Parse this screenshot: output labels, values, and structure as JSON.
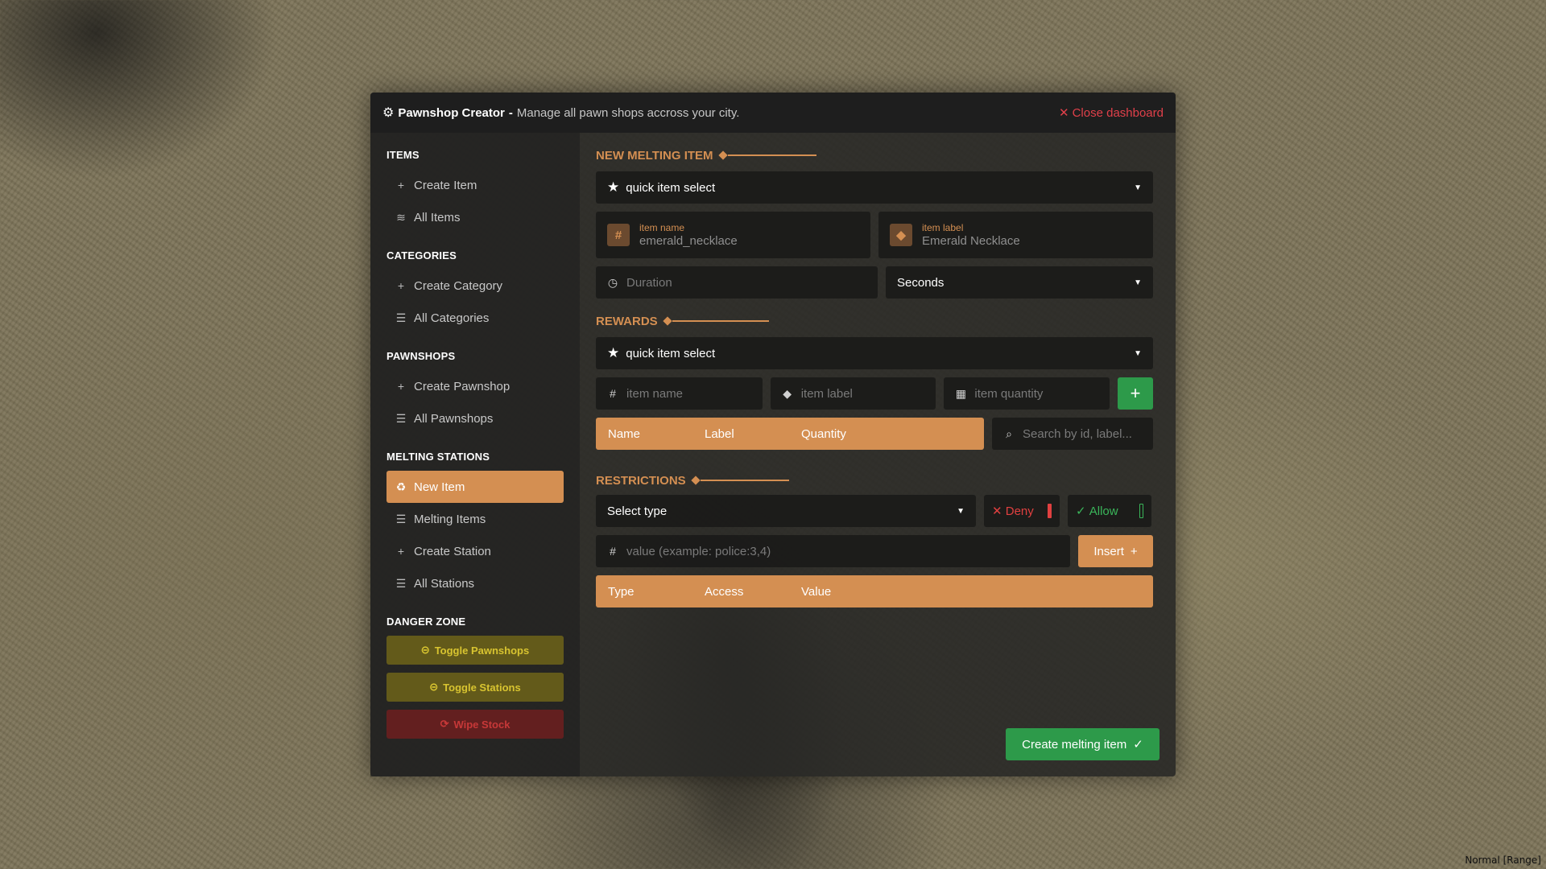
{
  "header": {
    "title": "Pawnshop Creator",
    "separator": "-",
    "subtitle": "Manage all pawn shops accross your city.",
    "close_label": "Close dashboard"
  },
  "sidebar": {
    "items_title": "ITEMS",
    "create_item": "Create Item",
    "all_items": "All Items",
    "categories_title": "CATEGORIES",
    "create_category": "Create Category",
    "all_categories": "All Categories",
    "pawnshops_title": "PAWNSHOPS",
    "create_pawnshop": "Create Pawnshop",
    "all_pawnshops": "All Pawnshops",
    "melting_title": "MELTING STATIONS",
    "new_item": "New Item",
    "melting_items": "Melting Items",
    "create_station": "Create Station",
    "all_stations": "All Stations",
    "danger_title": "DANGER ZONE",
    "toggle_pawnshops": "Toggle Pawnshops",
    "toggle_stations": "Toggle Stations",
    "wipe_stock": "Wipe Stock"
  },
  "new_melting": {
    "title": "NEW MELTING ITEM",
    "quick_select": "quick item select",
    "item_name_label": "item name",
    "item_name_value": "emerald_necklace",
    "item_label_label": "item label",
    "item_label_value": "Emerald Necklace",
    "duration_placeholder": "Duration",
    "duration_unit": "Seconds"
  },
  "rewards": {
    "title": "REWARDS",
    "quick_select": "quick item select",
    "name_placeholder": "item name",
    "label_placeholder": "item label",
    "quantity_placeholder": "item quantity",
    "columns": [
      "Name",
      "Label",
      "Quantity"
    ],
    "search_placeholder": "Search by id, label..."
  },
  "restrictions": {
    "title": "RESTRICTIONS",
    "select_type": "Select type",
    "deny": "Deny",
    "allow": "Allow",
    "value_placeholder": "value (example: police:3,4)",
    "insert": "Insert",
    "columns": [
      "Type",
      "Access",
      "Value"
    ]
  },
  "footer": {
    "create_label": "Create melting item"
  },
  "corner_text": "Normal [Range]",
  "colors": {
    "accent": "#d48f52",
    "success": "#2d9a4a",
    "danger": "#e04040",
    "warning": "#d8c430"
  }
}
